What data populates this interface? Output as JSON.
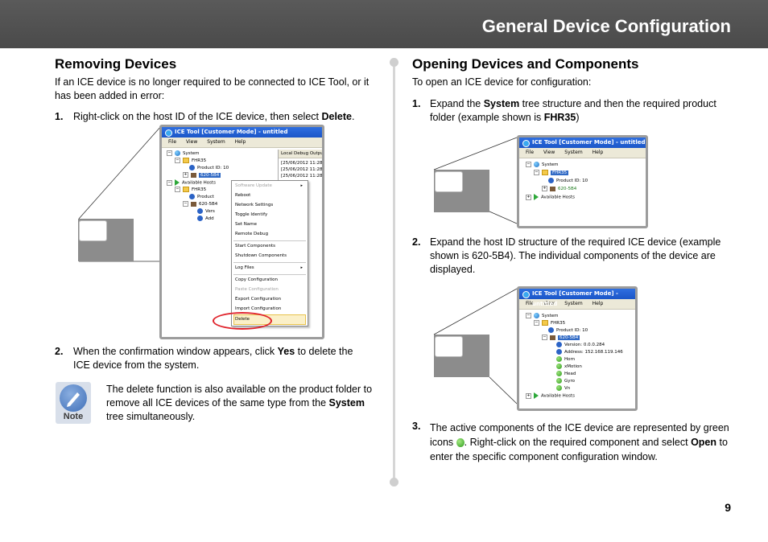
{
  "header": {
    "title": "General Device Configuration"
  },
  "left": {
    "heading": "Removing Devices",
    "intro": "If an ICE device is no longer required to be connected to ICE Tool, or it has been added in error:",
    "step1": {
      "num": "1.",
      "pre": "Right-click on the host ID of the ICE device, then select ",
      "bold": "Delete",
      "post": "."
    },
    "step2": {
      "num": "2.",
      "pre": "When the confirmation window appears, click ",
      "bold": "Yes",
      "post": " to delete the ICE device from the system."
    },
    "note": {
      "label": "Note",
      "pre": "The delete function is also available on the product folder to remove all ICE devices of the same type from the ",
      "bold": "System",
      "post": " tree simultaneously."
    }
  },
  "right": {
    "heading": "Opening Devices and Components",
    "intro": "To open an ICE device for configuration:",
    "step1": {
      "num": "1.",
      "a": "Expand the ",
      "b1": "System",
      "c": " tree structure and then the required product folder (example shown is ",
      "b2": "FHR35",
      "d": ")"
    },
    "step2": {
      "num": "2.",
      "text": "Expand the host ID structure of the required ICE device (example shown is 620-5B4). The individual components of the device are displayed."
    },
    "step3": {
      "num": "3.",
      "a": "The active components of the ICE device are represented by green icons ",
      "b": ". Right-click on the required component and select ",
      "bold": "Open",
      "c": " to enter the specific component configuration window."
    }
  },
  "screens": {
    "app_title": "ICE Tool [Customer Mode] - untitled",
    "menu": {
      "file": "File",
      "view": "View",
      "system": "System",
      "help": "Help"
    },
    "system": "System",
    "product_folder": "FHR35",
    "product_id": "Product ID: 10",
    "device": "620-5B4",
    "available_hosts": "Available Hosts",
    "version": "Version: 0.0.0.284",
    "address": "Address: 152.168.119.146",
    "components": [
      "Horn",
      "xMotion",
      "Head",
      "Gyro",
      "Vn"
    ],
    "debug_panel": {
      "title": "Local Debug Outpu",
      "lines": [
        "[25/06/2012 11:28",
        "[25/06/2012 11:28",
        "[25/06/2012 11:28"
      ]
    },
    "context_menu": {
      "software_update": "Software Update",
      "reboot": "Reboot",
      "network_settings": "Network Settings",
      "toggle_identify": "Toggle Identify",
      "set_name": "Set Name",
      "remote_debug": "Remote Debug",
      "start_components": "Start Components",
      "shutdown_components": "Shutdown Components",
      "log_files": "Log Files",
      "copy_configuration": "Copy Configuration",
      "paste_configuration": "Paste Configuration",
      "export_configuration": "Export Configuration",
      "import_configuration": "Import Configuration",
      "delete": "Delete"
    },
    "truncated": {
      "product": "Product",
      "ver": "Vers",
      "add": "Add"
    }
  },
  "page_number": "9"
}
